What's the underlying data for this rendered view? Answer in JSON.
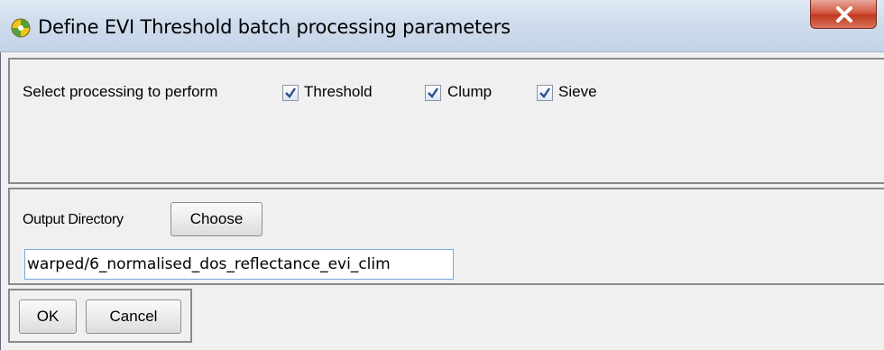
{
  "window": {
    "title": "Define EVI Threshold batch processing parameters",
    "icon": "qgis-app-icon",
    "close_icon": "close-icon"
  },
  "processing": {
    "label": "Select processing to perform",
    "options": [
      {
        "label": "Threshold",
        "checked": true
      },
      {
        "label": "Clump",
        "checked": true
      },
      {
        "label": "Sieve",
        "checked": true
      }
    ]
  },
  "output": {
    "label": "Output Directory",
    "choose_label": "Choose",
    "path_value": "warped/6_normalised_dos_reflectance_evi_clim"
  },
  "actions": {
    "ok_label": "OK",
    "cancel_label": "Cancel"
  },
  "colors": {
    "close_button": "#c0391f",
    "checkmark": "#2a4f8f",
    "input_border": "#7aa7d8"
  }
}
